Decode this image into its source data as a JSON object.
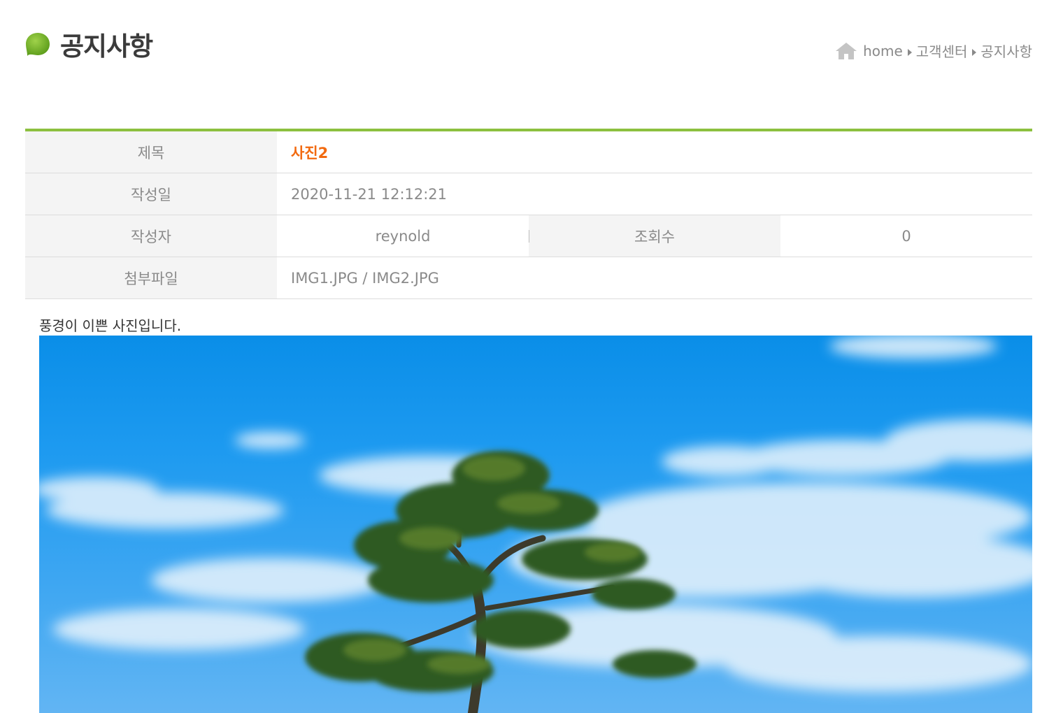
{
  "header": {
    "title": "공지사항",
    "bullet_color": "#7ab72e"
  },
  "breadcrumb": {
    "items": [
      "home",
      "고객센터",
      "공지사항"
    ]
  },
  "detail": {
    "accent_color": "#8cc03f",
    "title_label": "제목",
    "title_value": "사진2",
    "date_label": "작성일",
    "date_value": "2020-11-21 12:12:21",
    "author_label": "작성자",
    "author_value": "reynold",
    "views_label": "조회수",
    "views_value": "0",
    "attachment_label": "첨부파일",
    "attachment_value": "IMG1.JPG / IMG2.JPG"
  },
  "content": {
    "text": "풍경이 이쁜 사진입니다.",
    "image_subject": "wind-bent pine tree under blue sky with white clouds"
  }
}
